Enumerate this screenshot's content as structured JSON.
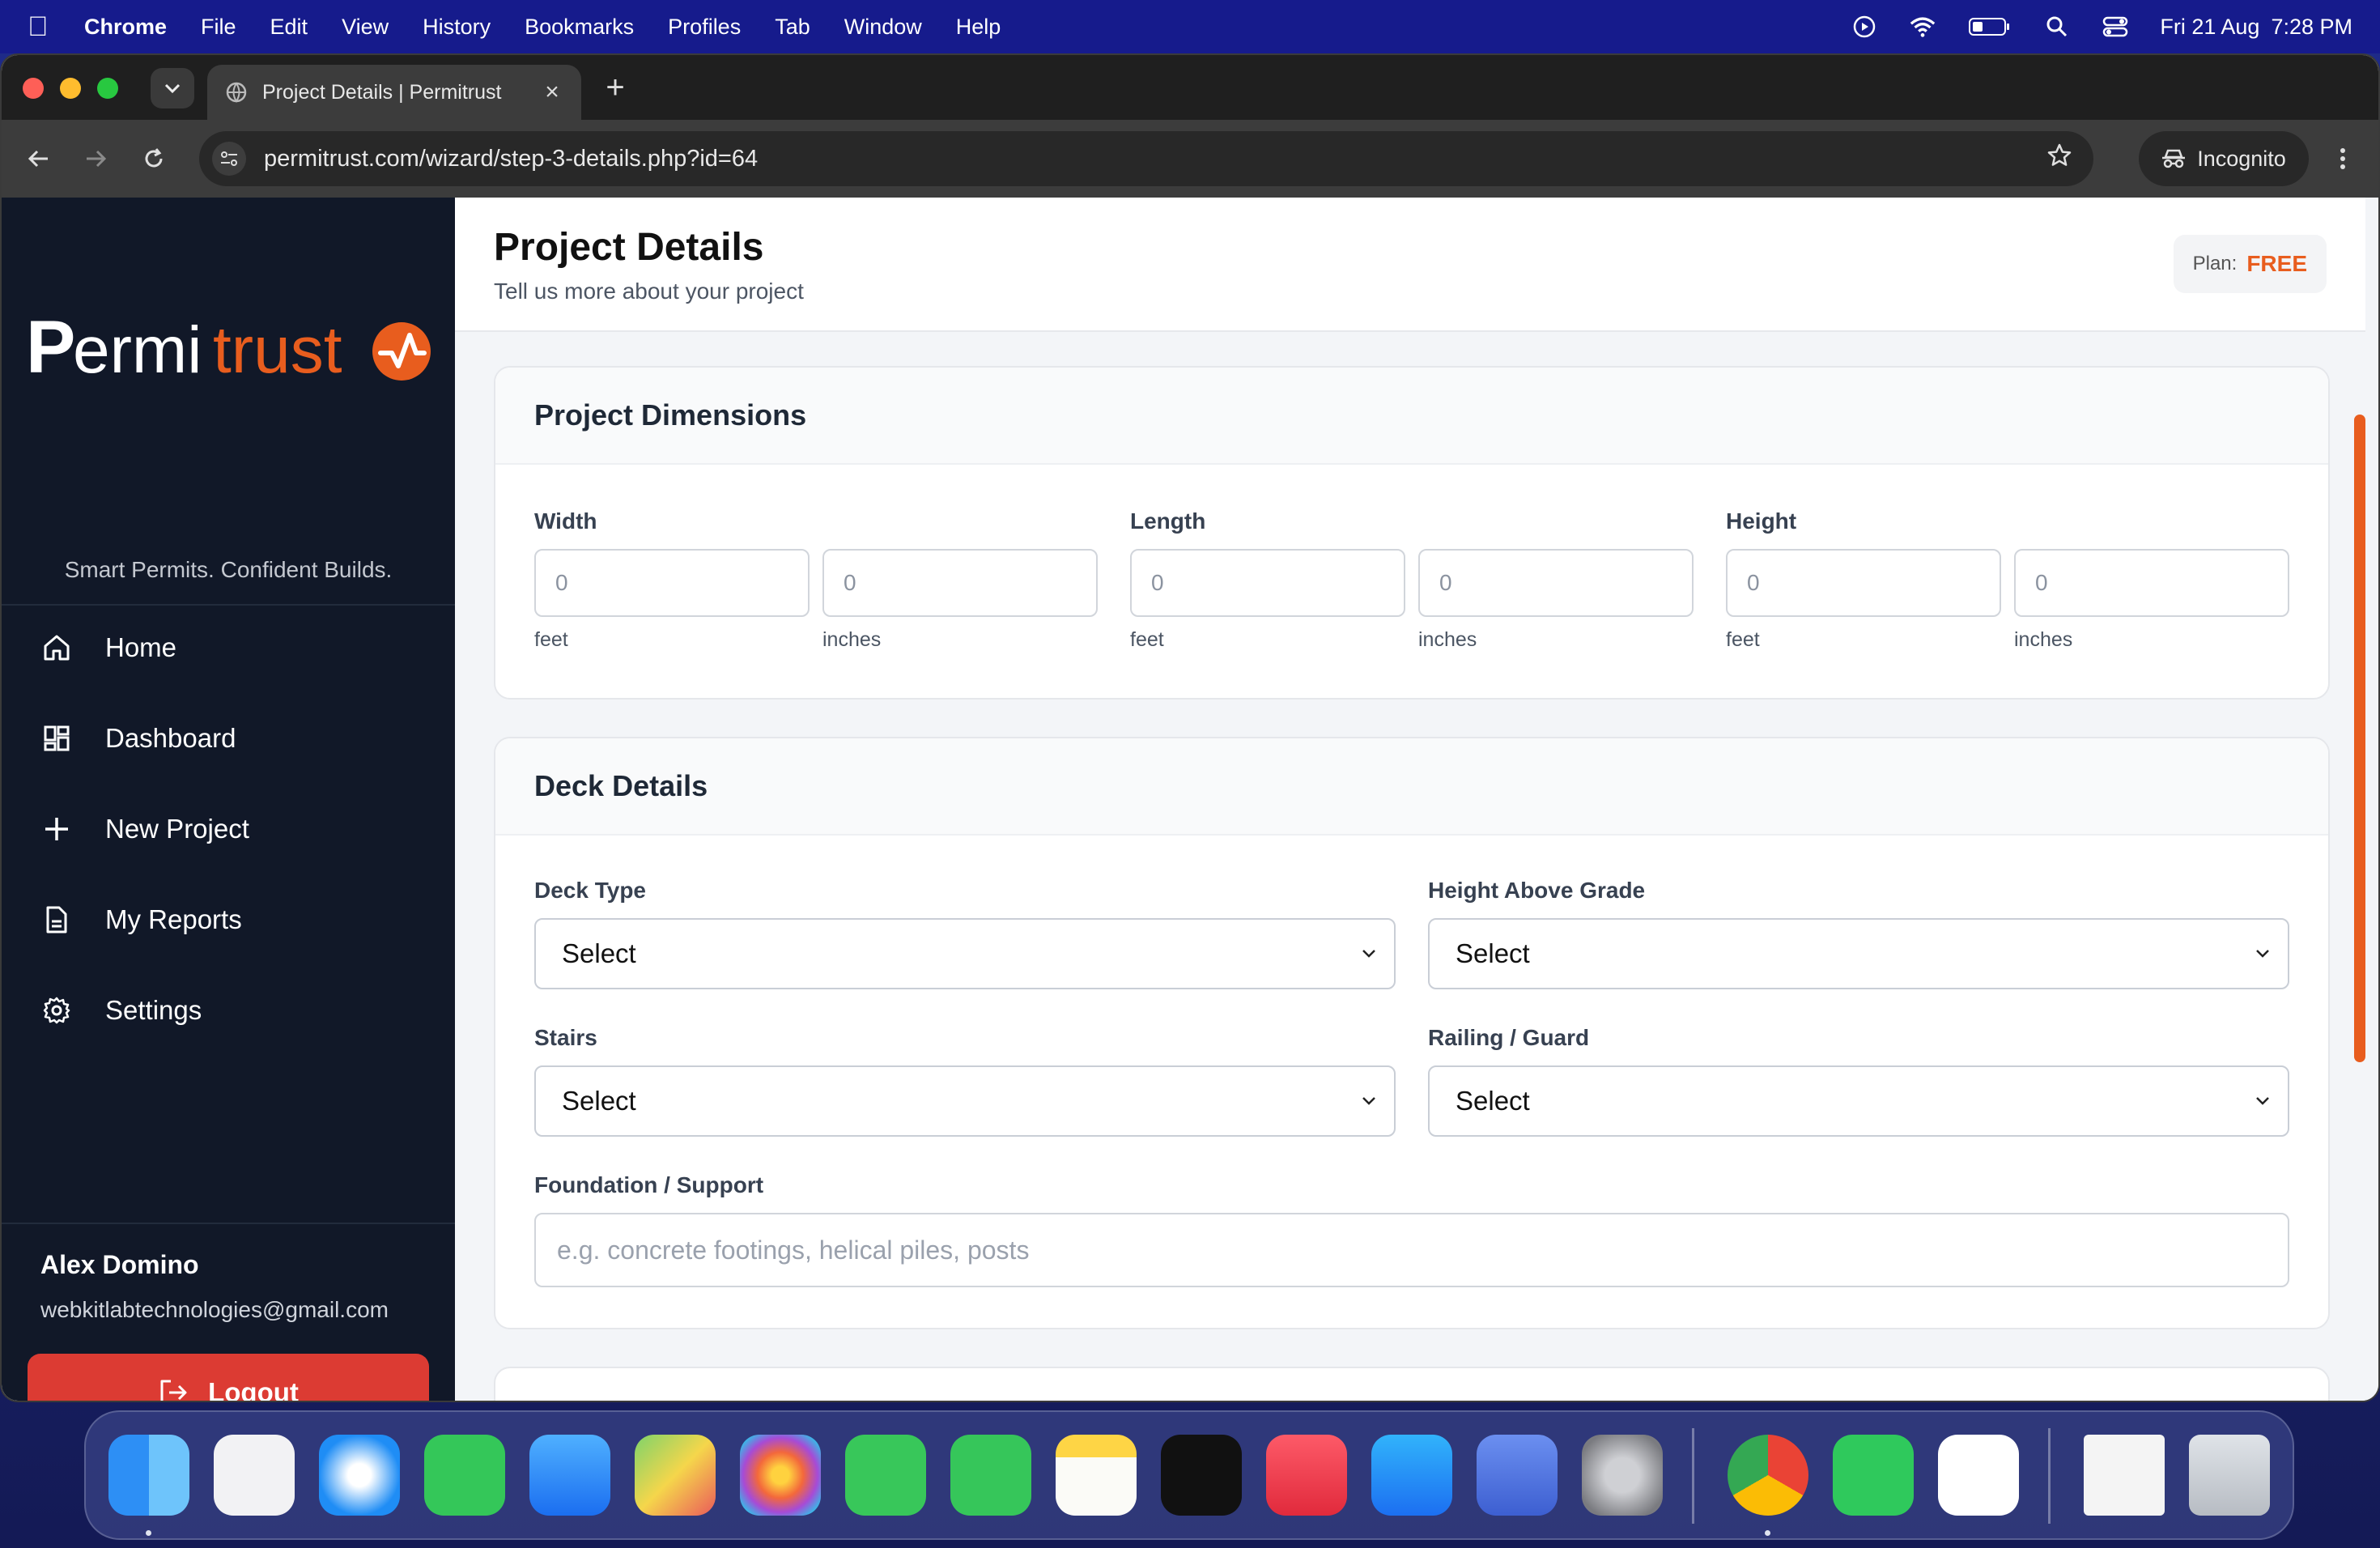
{
  "menubar": {
    "app_name": "Chrome",
    "menus": [
      "File",
      "Edit",
      "View",
      "History",
      "Bookmarks",
      "Profiles",
      "Tab",
      "Window",
      "Help"
    ],
    "date": "Fri 21 Aug",
    "time": "7:28 PM"
  },
  "browser": {
    "tab_title": "Project Details | Permitrust",
    "url": "permitrust.com/wizard/step-3-details.php?id=64",
    "incognito_label": "Incognito"
  },
  "sidebar": {
    "brand_start": "P",
    "brand_mid": "ermi",
    "brand_end": "trust",
    "tagline": "Smart Permits. Confident Builds.",
    "nav": [
      {
        "label": "Home",
        "icon": "home-icon"
      },
      {
        "label": "Dashboard",
        "icon": "dashboard-icon"
      },
      {
        "label": "New Project",
        "icon": "plus-icon"
      },
      {
        "label": "My Reports",
        "icon": "document-icon"
      },
      {
        "label": "Settings",
        "icon": "gear-icon"
      }
    ],
    "user_name": "Alex Domino",
    "user_email": "webkitlabtechnologies@gmail.com",
    "logout_label": "Logout"
  },
  "header": {
    "title": "Project Details",
    "subtitle": "Tell us more about your project",
    "plan_label": "Plan:",
    "plan_value": "FREE"
  },
  "dimensions": {
    "title": "Project Dimensions",
    "width": {
      "label": "Width",
      "feet_placeholder": "0",
      "inches_placeholder": "0",
      "feet_unit": "feet",
      "inches_unit": "inches"
    },
    "length": {
      "label": "Length",
      "feet_placeholder": "0",
      "inches_placeholder": "0",
      "feet_unit": "feet",
      "inches_unit": "inches"
    },
    "height": {
      "label": "Height",
      "feet_placeholder": "0",
      "inches_placeholder": "0",
      "feet_unit": "feet",
      "inches_unit": "inches"
    }
  },
  "deck": {
    "title": "Deck Details",
    "deck_type": {
      "label": "Deck Type",
      "value": "Select"
    },
    "height_above_grade": {
      "label": "Height Above Grade",
      "value": "Select"
    },
    "stairs": {
      "label": "Stairs",
      "value": "Select"
    },
    "railing": {
      "label": "Railing / Guard",
      "value": "Select"
    },
    "foundation": {
      "label": "Foundation / Support",
      "placeholder": "e.g. concrete footings, helical piles, posts"
    }
  },
  "colors": {
    "brand_orange": "#e85d1e",
    "sidebar_bg": "#111828",
    "logout_red": "#dc3b33"
  }
}
